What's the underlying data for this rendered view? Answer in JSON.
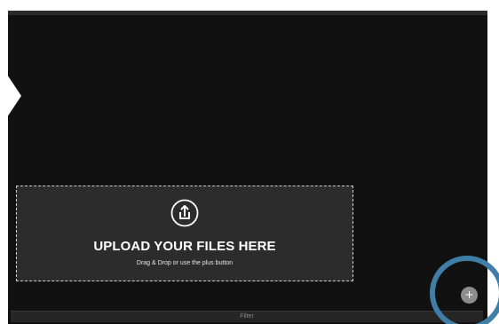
{
  "upload": {
    "title": "UPLOAD YOUR FILES HERE",
    "subtitle": "Drag & Drop or use the plus button",
    "icon": "upload-icon"
  },
  "filter": {
    "label": "Filter"
  },
  "fab": {
    "symbol": "+",
    "icon": "plus-icon"
  },
  "colors": {
    "panel": "#111111",
    "dropzone": "#2c2c2c",
    "highlight_ring": "#3f7ea7"
  }
}
